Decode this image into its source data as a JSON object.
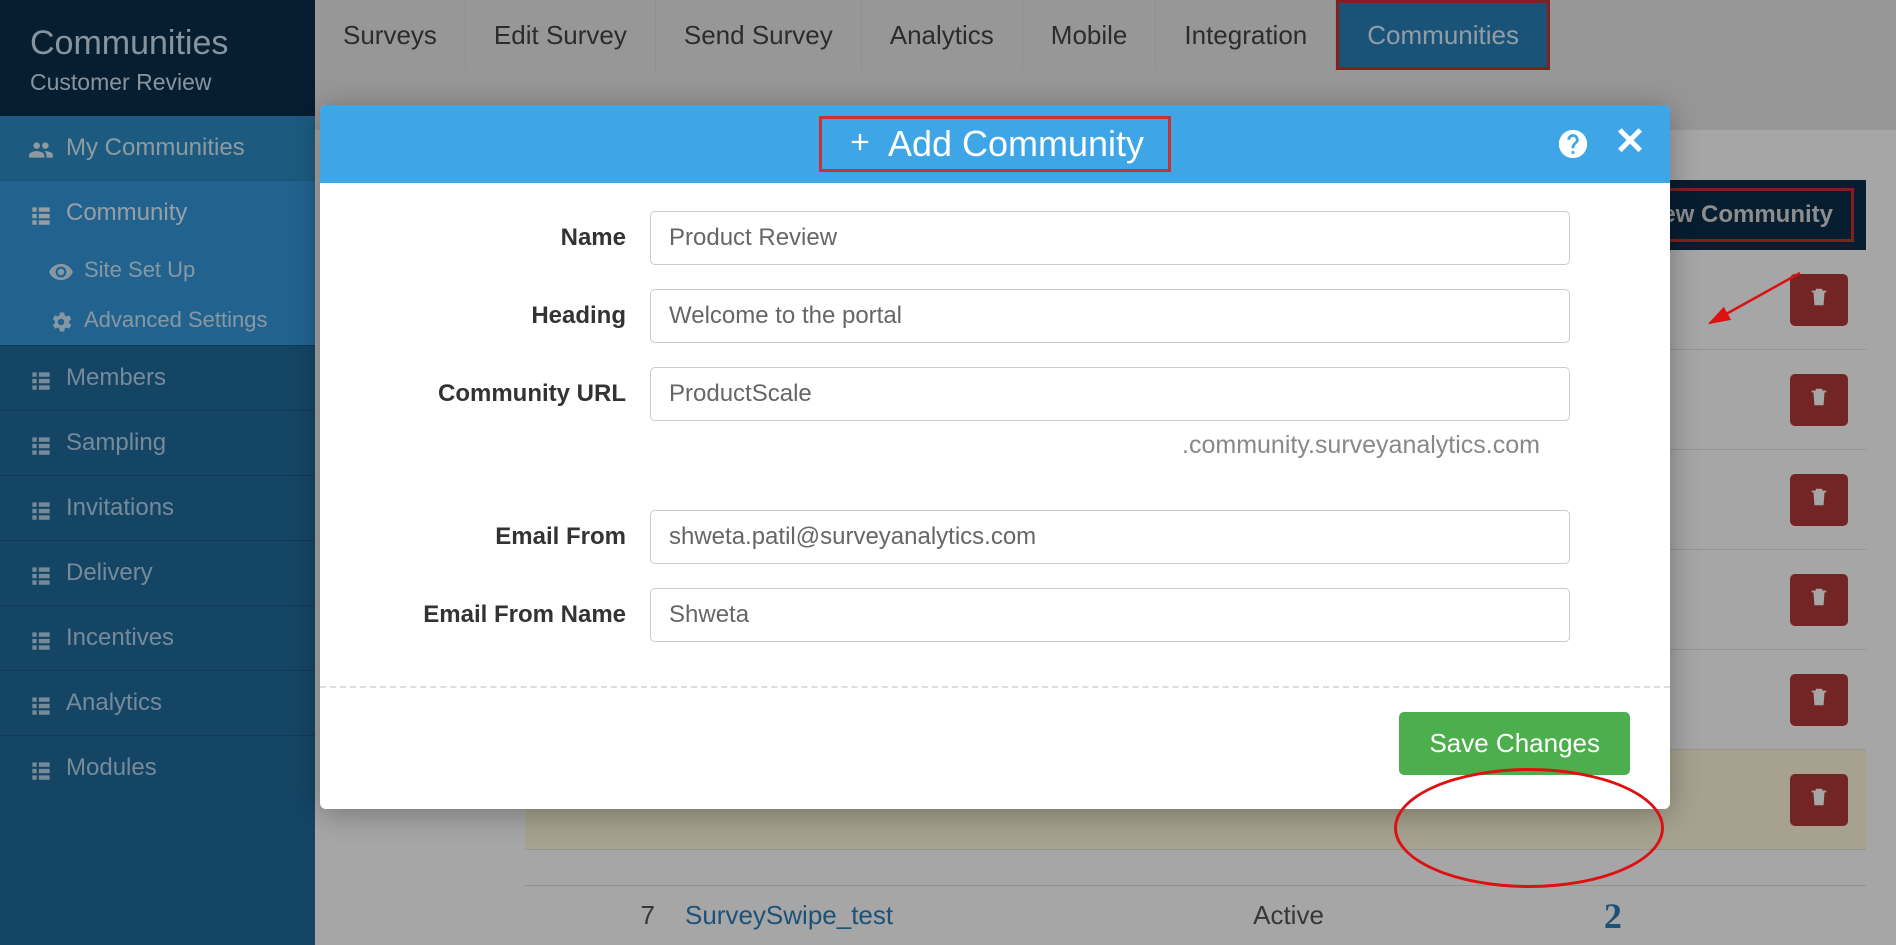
{
  "header": {
    "title": "Communities",
    "subtitle": "Customer Review"
  },
  "sidebar": {
    "my_communities": "My Communities",
    "community": "Community",
    "site_setup": "Site Set Up",
    "advanced_settings": "Advanced Settings",
    "members": "Members",
    "sampling": "Sampling",
    "invitations": "Invitations",
    "delivery": "Delivery",
    "incentives": "Incentives",
    "analytics": "Analytics",
    "modules": "Modules"
  },
  "tabs": {
    "surveys": "Surveys",
    "edit_survey": "Edit Survey",
    "send_survey": "Send Survey",
    "analytics": "Analytics",
    "mobile": "Mobile",
    "integration": "Integration",
    "communities": "Communities"
  },
  "toolbar": {
    "new_community": "New Community"
  },
  "table": {
    "row_num": "7",
    "row_name": "SurveySwipe_test",
    "row_status": "Active",
    "row_count": "2"
  },
  "modal": {
    "title": "Add Community",
    "name_label": "Name",
    "name_value": "Product Review",
    "heading_label": "Heading",
    "heading_value": "Welcome to the portal",
    "url_label": "Community URL",
    "url_value": "ProductScale",
    "url_suffix": ".community.surveyanalytics.com",
    "email_from_label": "Email From",
    "email_from_value": "shweta.patil@surveyanalytics.com",
    "email_name_label": "Email From Name",
    "email_name_value": "Shweta",
    "save_button": "Save Changes"
  }
}
